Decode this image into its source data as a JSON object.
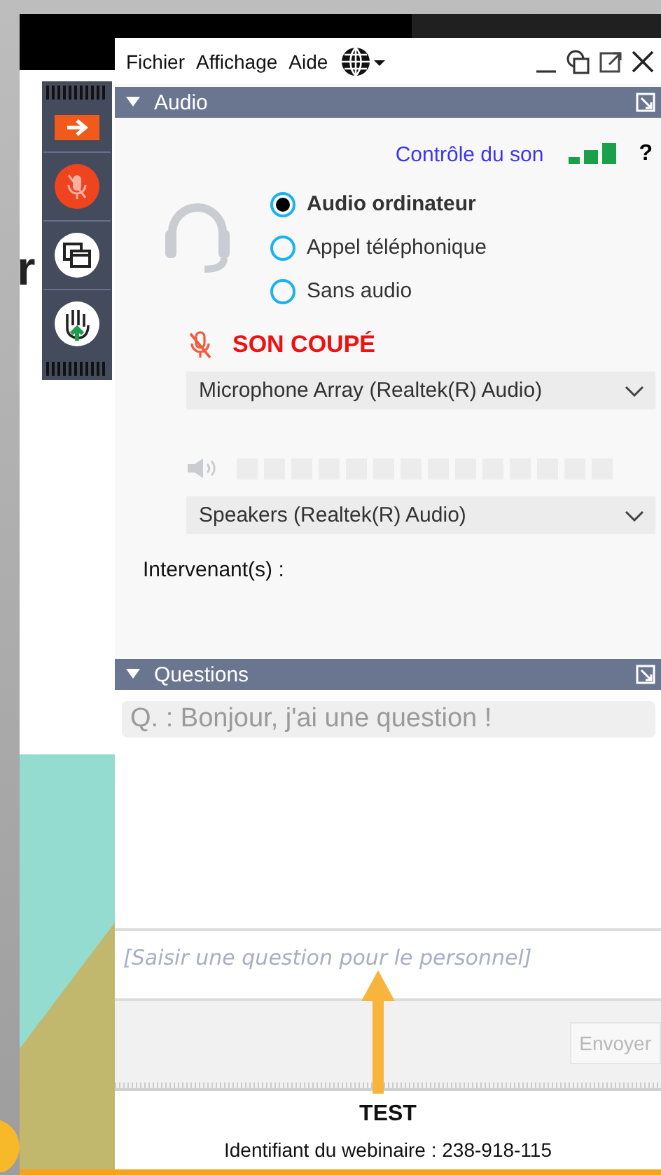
{
  "backdrop": {
    "letter": "r"
  },
  "toolbar": [
    {
      "kind": "arrow"
    },
    {
      "kind": "mic-muted"
    },
    {
      "kind": "screens"
    },
    {
      "kind": "hand"
    }
  ],
  "menu": [
    {
      "label": "Fichier"
    },
    {
      "label": "Affichage"
    },
    {
      "label": "Aide"
    }
  ],
  "audio_panel": {
    "title": "Audio",
    "sound_control": "Contrôle du son",
    "help": "?",
    "options": [
      {
        "label": "Audio ordinateur",
        "selected": true
      },
      {
        "label": "Appel téléphonique",
        "selected": false
      },
      {
        "label": "Sans audio",
        "selected": false
      }
    ],
    "muted": true,
    "mute_status": "SON COUPÉ",
    "microphone": "Microphone Array (Realtek(R) Audio)",
    "speaker_meter": {
      "level": 0
    },
    "speakers": "Speakers (Realtek(R) Audio)",
    "presenters_label": "Intervenant(s) :"
  },
  "questions_panel": {
    "title": "Questions",
    "questions": [
      "Q. : Bonjour, j'ai une question !"
    ],
    "input": {
      "placeholder": "[Saisir une question pour le personnel]"
    },
    "send_button": {
      "label": "Envoyer",
      "disabled": true
    }
  },
  "footer": {
    "title": "TEST",
    "webinar_id": "Identifiant du webinaire : 238-918-115"
  }
}
